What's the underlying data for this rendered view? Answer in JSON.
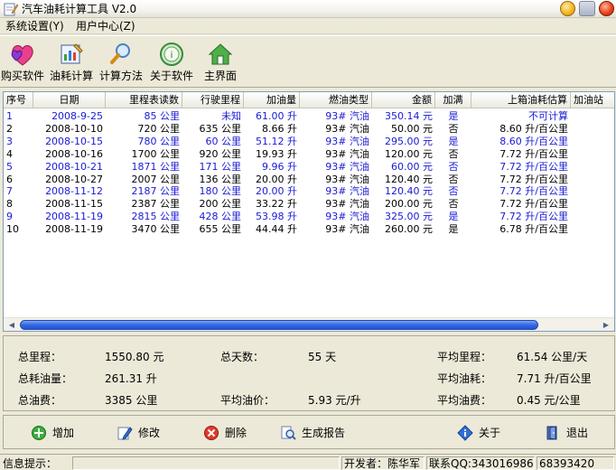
{
  "window": {
    "title": "汽车油耗计算工具 V2.0"
  },
  "menu": [
    {
      "label": "系统设置(Y)"
    },
    {
      "label": "用户中心(Z)"
    }
  ],
  "toolbar": [
    {
      "label": "购买软件",
      "icon": "hearts-icon"
    },
    {
      "label": "油耗计算",
      "icon": "edit-chart-icon"
    },
    {
      "label": "计算方法",
      "icon": "magnifier-icon"
    },
    {
      "label": "关于软件",
      "icon": "about-globe-icon"
    },
    {
      "label": "主界面",
      "icon": "home-icon"
    }
  ],
  "table": {
    "columns": [
      "序号",
      "日期",
      "里程表读数",
      "行驶里程",
      "加油量",
      "燃油类型",
      "金额",
      "加满",
      "上箱油耗估算",
      "加油站"
    ],
    "rows": [
      [
        "1",
        "2008-9-25",
        "85 公里",
        "未知",
        "61.00 升",
        "93# 汽油",
        "350.14 元",
        "是",
        "不可计算",
        ""
      ],
      [
        "2",
        "2008-10-10",
        "720 公里",
        "635 公里",
        "8.66 升",
        "93# 汽油",
        "50.00 元",
        "否",
        "8.60 升/百公里",
        ""
      ],
      [
        "3",
        "2008-10-15",
        "780 公里",
        "60 公里",
        "51.12 升",
        "93# 汽油",
        "295.00 元",
        "是",
        "8.60 升/百公里",
        ""
      ],
      [
        "4",
        "2008-10-16",
        "1700 公里",
        "920 公里",
        "19.93 升",
        "93# 汽油",
        "120.00 元",
        "否",
        "7.72 升/百公里",
        ""
      ],
      [
        "5",
        "2008-10-21",
        "1871 公里",
        "171 公里",
        "9.96 升",
        "93# 汽油",
        "60.00 元",
        "否",
        "7.72 升/百公里",
        ""
      ],
      [
        "6",
        "2008-10-27",
        "2007 公里",
        "136 公里",
        "20.00 升",
        "93# 汽油",
        "120.40 元",
        "否",
        "7.72 升/百公里",
        ""
      ],
      [
        "7",
        "2008-11-12",
        "2187 公里",
        "180 公里",
        "20.00 升",
        "93# 汽油",
        "120.40 元",
        "否",
        "7.72 升/百公里",
        ""
      ],
      [
        "8",
        "2008-11-15",
        "2387 公里",
        "200 公里",
        "33.22 升",
        "93# 汽油",
        "200.00 元",
        "否",
        "7.72 升/百公里",
        ""
      ],
      [
        "9",
        "2008-11-19",
        "2815 公里",
        "428 公里",
        "53.98 升",
        "93# 汽油",
        "325.00 元",
        "是",
        "7.72 升/百公里",
        ""
      ],
      [
        "10",
        "2008-11-19",
        "3470 公里",
        "655 公里",
        "44.44 升",
        "93# 汽油",
        "260.00 元",
        "是",
        "6.78 升/百公里",
        ""
      ]
    ],
    "row_colors": [
      "blue",
      "black",
      "blue",
      "black",
      "blue",
      "black",
      "blue",
      "black",
      "blue",
      "black"
    ]
  },
  "summary": {
    "total_mileage_label": "总里程：",
    "total_mileage_value": "1550.80 元",
    "total_days_label": "总天数：",
    "total_days_value": "55 天",
    "avg_mileage_label": "平均里程：",
    "avg_mileage_value": "61.54 公里/天",
    "total_fuel_label": "总耗油量：",
    "total_fuel_value": "261.31 升",
    "avg_consumption_label": "平均油耗：",
    "avg_consumption_value": "7.71 升/百公里",
    "total_cost_label": "总油费：",
    "total_cost_value": "3385 公里",
    "avg_price_label": "平均油价：",
    "avg_price_value": "5.93 元/升",
    "avg_cost_label": "平均油费：",
    "avg_cost_value": "0.45  元/公里"
  },
  "actions": [
    {
      "label": "增加",
      "icon": "plus-icon"
    },
    {
      "label": "修改",
      "icon": "pencil-icon"
    },
    {
      "label": "删除",
      "icon": "delete-icon"
    },
    {
      "label": "生成报告",
      "icon": "report-search-icon"
    },
    {
      "label": "关于",
      "icon": "info-icon"
    },
    {
      "label": "退出",
      "icon": "exit-door-icon"
    }
  ],
  "status": {
    "info_label": "信息提示：",
    "developer": "开发者：陈华军",
    "contact": "联系QQ:343016986",
    "phone": "68393420"
  },
  "colors": {
    "accent_blue": "#1a1ad6",
    "scroll_thumb": "#3468e3"
  }
}
